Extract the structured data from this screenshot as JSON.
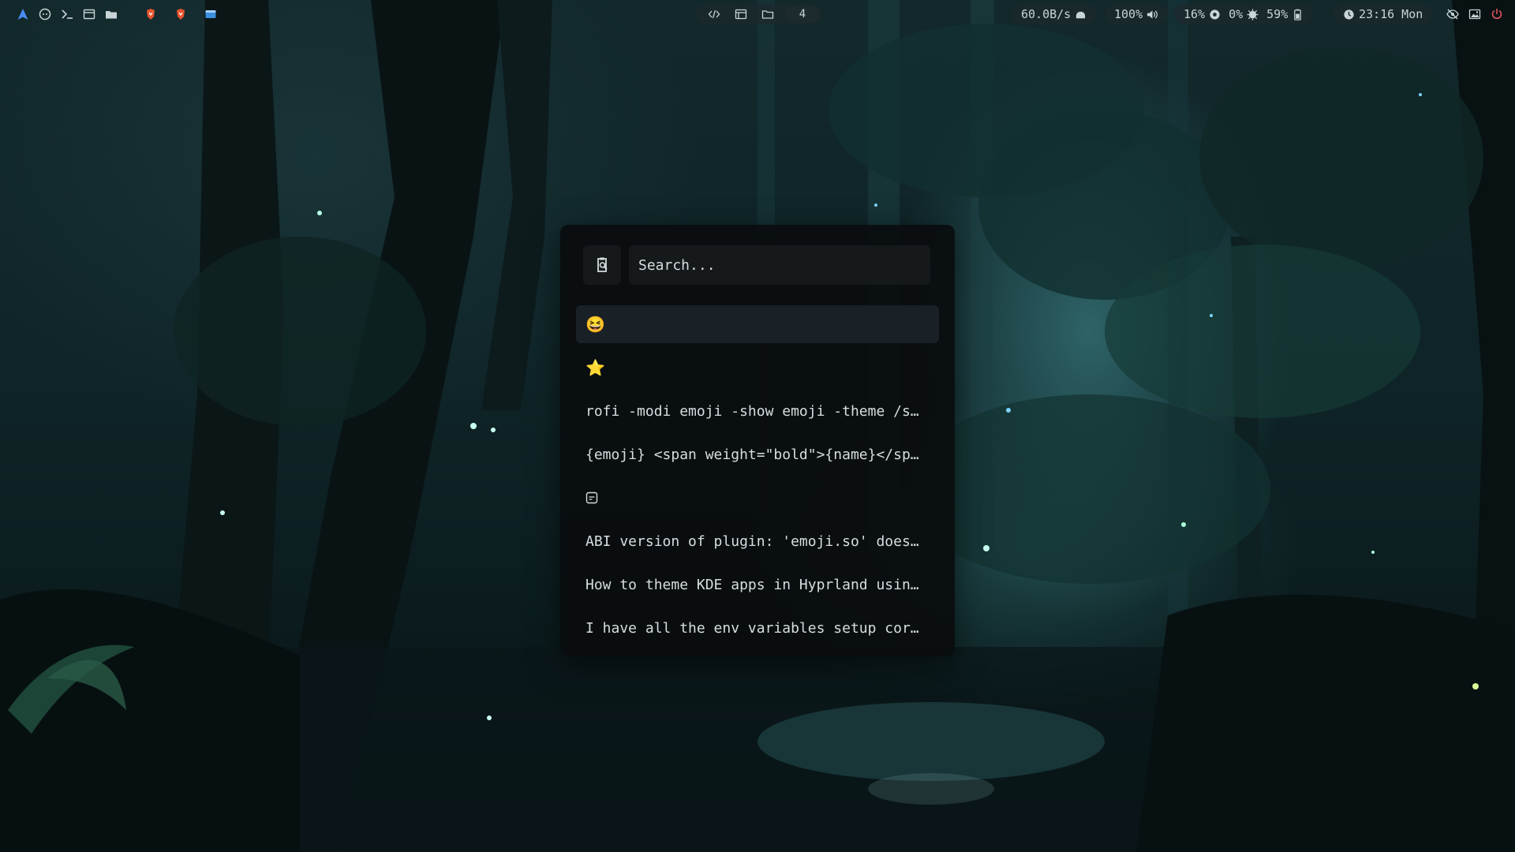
{
  "topbar": {
    "left_icons": [
      "arch-logo-icon",
      "github-icon",
      "terminal-icon",
      "calendar-window-icon",
      "folder-icon",
      "brave-browser-icon",
      "brave-browser-icon",
      "file-manager-icon"
    ],
    "workspaces": {
      "icons": [
        "code-icon",
        "window-icon",
        "folder-icon"
      ],
      "active_label": "4"
    },
    "network": {
      "speed": "60.0B/s"
    },
    "volume": {
      "level": "100%"
    },
    "system": {
      "cpu": "16%",
      "memory": "0%",
      "battery": "59%"
    },
    "clock": {
      "time": "23:16 Mon"
    },
    "right_icons": [
      "eye-off-icon",
      "image-icon",
      "power-icon"
    ]
  },
  "launcher": {
    "search": {
      "placeholder": "Search...",
      "value": ""
    },
    "items": [
      {
        "label": "😆",
        "selected": true
      },
      {
        "label": "⭐",
        "selected": false
      },
      {
        "label": "rofi -modi emoji -show emoji -theme /s…",
        "selected": false
      },
      {
        "label": "{emoji} <span weight=\"bold\">{name}</sp…",
        "selected": false
      },
      {
        "label": "",
        "icon": "clipboard-image-icon",
        "selected": false
      },
      {
        "label": "ABI version of plugin: 'emoji.so' does…",
        "selected": false
      },
      {
        "label": "How to theme KDE apps in Hyprland usin…",
        "selected": false
      },
      {
        "label": "I have all the env variables setup cor…",
        "selected": false
      }
    ]
  },
  "colors": {
    "launcher_bg": "#0a0d0f",
    "selected_bg": "#1a2126",
    "text": "#d8dde0",
    "accent_blue": "#4a8cf0",
    "brave_orange": "#e8552f"
  }
}
